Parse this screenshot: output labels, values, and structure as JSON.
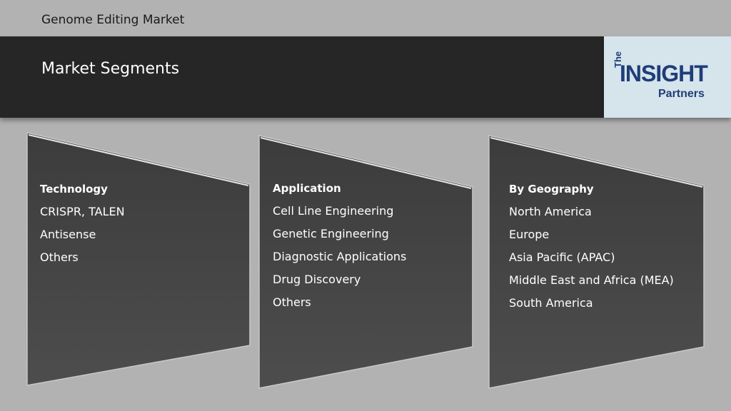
{
  "slide": {
    "top_title": "Genome Editing Market",
    "header_title": "Market Segments"
  },
  "logo": {
    "the": "The",
    "insight": "INSIGHT",
    "partners": "Partners"
  },
  "segments": [
    {
      "title": "Technology",
      "items": [
        "CRISPR, TALEN",
        "Antisense",
        "Others"
      ]
    },
    {
      "title": "Application",
      "items": [
        "Cell Line Engineering",
        "Genetic Engineering",
        "Diagnostic Applications",
        "Drug Discovery",
        "Others"
      ]
    },
    {
      "title": "By Geography",
      "items": [
        "North America",
        "Europe",
        "Asia Pacific (APAC)",
        "Middle East and Africa (MEA)",
        "South America"
      ]
    }
  ],
  "colors": {
    "background": "#b2b2b2",
    "header": "#262626",
    "panel": "#474747",
    "logo_blue": "#1f3d78"
  }
}
